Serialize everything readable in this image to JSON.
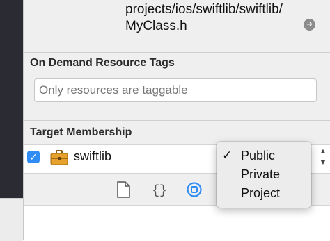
{
  "path": {
    "line1": "projects/ios/swiftlib/swiftlib/",
    "line2": "MyClass.h",
    "reveal_icon": "arrow-right-circle-icon"
  },
  "on_demand_tags": {
    "title": "On Demand Resource Tags",
    "placeholder": "Only resources are taggable"
  },
  "target_membership": {
    "title": "Target Membership",
    "targets": [
      {
        "name": "swiftlib",
        "checked": true,
        "icon": "toolbox-icon"
      }
    ]
  },
  "visibility_menu": {
    "checkmark": "✓",
    "options": [
      "Public",
      "Private",
      "Project"
    ],
    "selected": "Public"
  },
  "inspector_tabs": {
    "icons": [
      "file-icon",
      "braces-icon",
      "target-circle-icon"
    ],
    "selected": "target-circle-icon"
  },
  "colors": {
    "accent": "#2f8cf5",
    "editor_background": "#2a2b33",
    "inspector_background": "#efefef"
  }
}
